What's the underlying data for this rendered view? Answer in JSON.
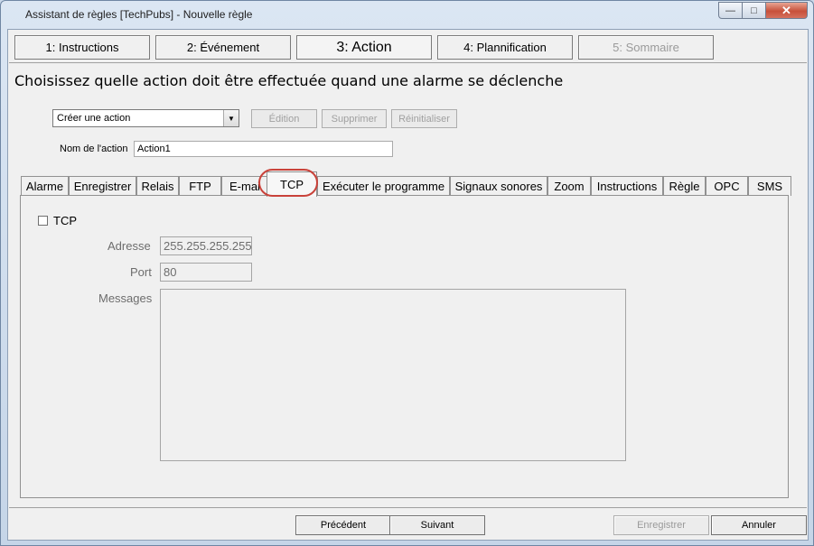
{
  "window": {
    "title": "Assistant de règles [TechPubs] - Nouvelle règle",
    "controls": {
      "minimize": "—",
      "maximize": "□",
      "close": "✕"
    }
  },
  "steps": [
    {
      "label": "1: Instructions",
      "state": "normal"
    },
    {
      "label": "2: Événement",
      "state": "normal"
    },
    {
      "label": "3: Action",
      "state": "active"
    },
    {
      "label": "4: Plannification",
      "state": "normal"
    },
    {
      "label": "5: Sommaire",
      "state": "disabled"
    }
  ],
  "heading": "Choisissez quelle action doit être effectuée quand une alarme se déclenche",
  "action_select": {
    "value": "Créer une action",
    "arrow_icon": "chevron-down-icon"
  },
  "action_buttons": {
    "edit": "Édition",
    "delete": "Supprimer",
    "reset": "Réinitialiser"
  },
  "action_name": {
    "label": "Nom de l'action",
    "value": "Action1"
  },
  "tabs": [
    "Alarme",
    "Enregistrer",
    "Relais",
    "FTP",
    "E-mail",
    "TCP",
    "Exécuter le programme",
    "Signaux sonores",
    "Zoom",
    "Instructions",
    "Règle",
    "OPC",
    "SMS"
  ],
  "tab_visible_labels": {
    "e_mail_clipped": "E-mai"
  },
  "active_tab": "TCP",
  "tcp": {
    "checkbox_label": "TCP",
    "checked": false,
    "address_label": "Adresse",
    "address_value": "255.255.255.255",
    "port_label": "Port",
    "port_value": "80",
    "messages_label": "Messages",
    "messages_value": ""
  },
  "footer": {
    "previous": "Précédent",
    "next": "Suivant",
    "save": "Enregistrer",
    "cancel": "Annuler"
  },
  "colors": {
    "highlight": "#c9423a",
    "panel": "#f0f0f0"
  }
}
